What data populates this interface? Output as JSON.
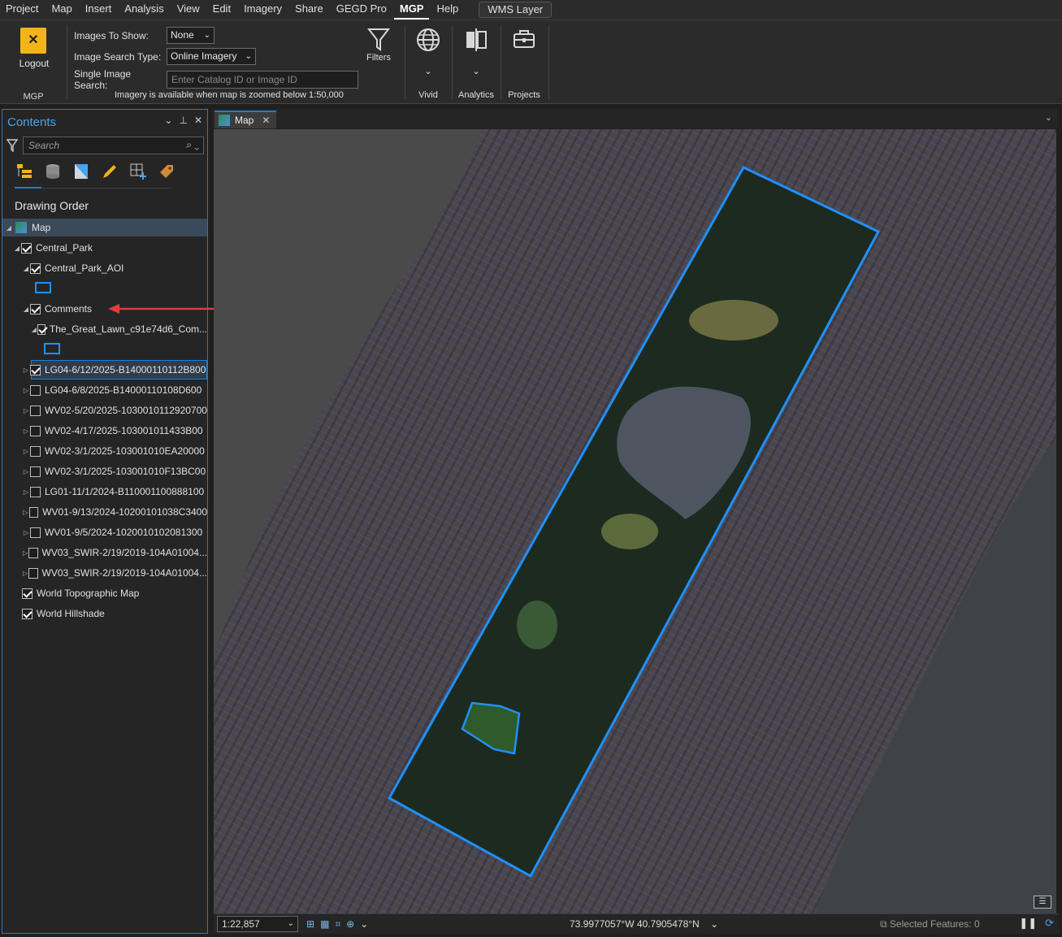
{
  "menu": {
    "items": [
      "Project",
      "Map",
      "Insert",
      "Analysis",
      "View",
      "Edit",
      "Imagery",
      "Share",
      "GEGD Pro",
      "MGP",
      "Help"
    ],
    "active": "MGP",
    "contextual_tab": "WMS Layer"
  },
  "ribbon": {
    "logout_label": "Logout",
    "mgp_group_label": "MGP",
    "images_to_show_label": "Images To Show:",
    "images_to_show_value": "None",
    "image_search_type_label": "Image Search Type:",
    "image_search_type_value": "Online Imagery",
    "single_image_search_label": "Single Image Search:",
    "single_image_search_placeholder": "Enter Catalog ID or Image ID",
    "imagery_note": "Imagery is available when map is zoomed below 1:50,000",
    "filters_label": "Filters",
    "vivid_label": "Vivid",
    "analytics_label": "Analytics",
    "projects_label": "Projects"
  },
  "contents": {
    "title": "Contents",
    "search_placeholder": "Search",
    "drawing_order": "Drawing Order",
    "annotation_arrow_color": "#e03c3c",
    "rows": [
      {
        "label": "Map",
        "checkbox": false,
        "checked": false
      },
      {
        "label": "Central_Park",
        "checkbox": true,
        "checked": true
      },
      {
        "label": "Central_Park_AOI",
        "checkbox": true,
        "checked": true
      },
      {
        "label": "Comments",
        "checkbox": true,
        "checked": true
      },
      {
        "label": "The_Great_Lawn_c91e74d6_Com...",
        "checkbox": true,
        "checked": true
      },
      {
        "label": "LG04-6/12/2025-B14000110112B800",
        "checkbox": true,
        "checked": true,
        "selected": true
      },
      {
        "label": "LG04-6/8/2025-B14000110108D600",
        "checkbox": true,
        "checked": false
      },
      {
        "label": "WV02-5/20/2025-1030010112920700",
        "checkbox": true,
        "checked": false
      },
      {
        "label": "WV02-4/17/2025-103001011433B00",
        "checkbox": true,
        "checked": false
      },
      {
        "label": "WV02-3/1/2025-103001010EA20000",
        "checkbox": true,
        "checked": false
      },
      {
        "label": "WV02-3/1/2025-103001010F13BC00",
        "checkbox": true,
        "checked": false
      },
      {
        "label": "LG01-11/1/2024-B110001100888100",
        "checkbox": true,
        "checked": false
      },
      {
        "label": "WV01-9/13/2024-10200101038C3400",
        "checkbox": true,
        "checked": false
      },
      {
        "label": "WV01-9/5/2024-1020010102081300",
        "checkbox": true,
        "checked": false
      },
      {
        "label": "WV03_SWIR-2/19/2019-104A01004...",
        "checkbox": true,
        "checked": false
      },
      {
        "label": "WV03_SWIR-2/19/2019-104A01004...",
        "checkbox": true,
        "checked": false
      },
      {
        "label": "World Topographic Map",
        "checkbox": true,
        "checked": true
      },
      {
        "label": "World Hillshade",
        "checkbox": true,
        "checked": true
      }
    ]
  },
  "map": {
    "tab_label": "Map",
    "aoi_color": "#1e90ff"
  },
  "status": {
    "scale": "1:22,857",
    "coordinates": "73.9977057°W 40.7905478°N",
    "selected_features": "Selected Features: 0"
  }
}
